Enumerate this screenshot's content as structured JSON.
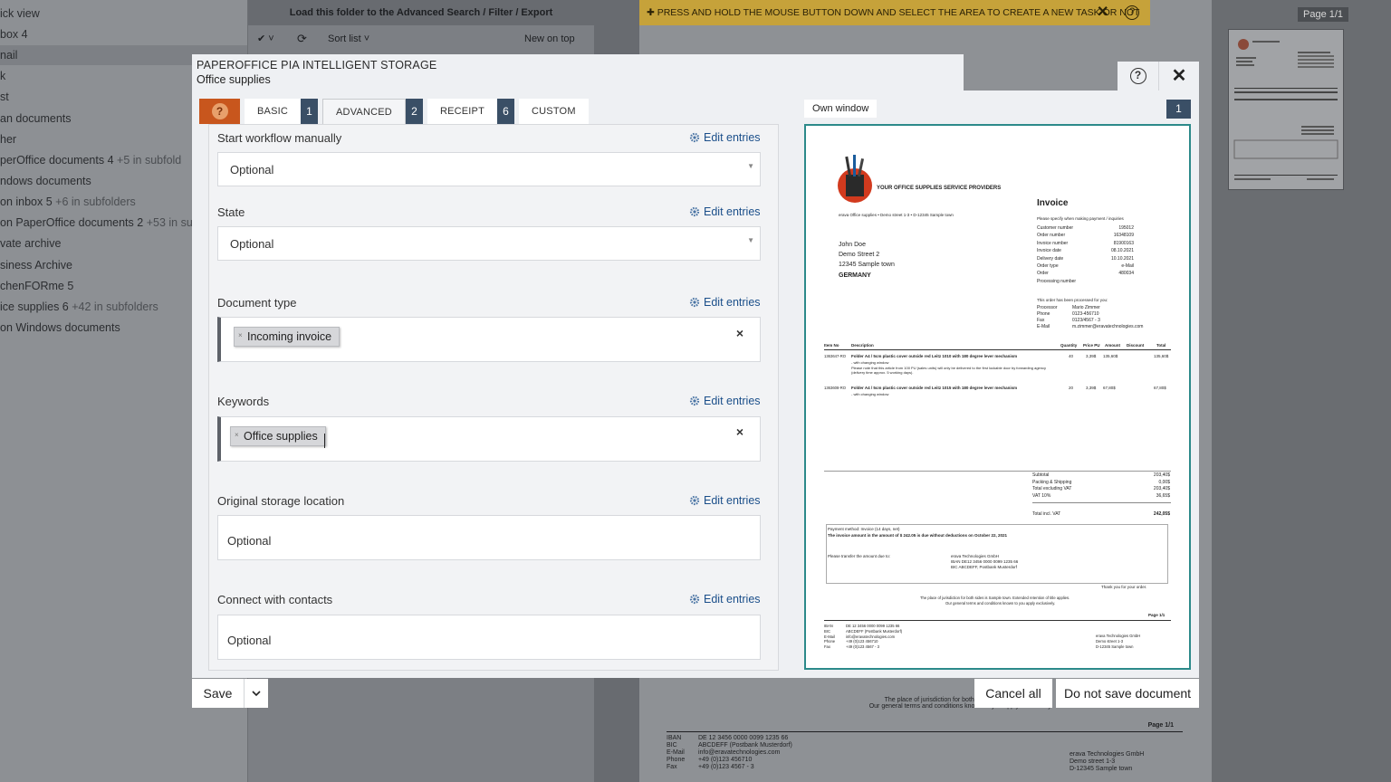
{
  "background": {
    "sidebar_items": [
      {
        "label": "ick view",
        "sub": ""
      },
      {
        "label": "box 4",
        "sub": ""
      },
      {
        "label": "nail",
        "sub": ""
      },
      {
        "label": "k",
        "sub": ""
      },
      {
        "label": "st",
        "sub": ""
      },
      {
        "label": "an documents",
        "sub": ""
      },
      {
        "label": "her",
        "sub": ""
      },
      {
        "label": "perOffice documents 4",
        "sub": "+5 in subfold"
      },
      {
        "label": "ndows documents",
        "sub": ""
      },
      {
        "label": "on inbox 5",
        "sub": "+6 in subfolders"
      },
      {
        "label": "on PaperOffice documents 2",
        "sub": "+53 in sub"
      },
      {
        "label": "vate archive",
        "sub": ""
      },
      {
        "label": "siness Archive",
        "sub": ""
      },
      {
        "label": "chenFORme 5",
        "sub": ""
      },
      {
        "label": "ice supplies 6",
        "sub": "+42 in subfolders"
      },
      {
        "label": "on Windows documents",
        "sub": ""
      }
    ],
    "list_toolbar_title": "Load this folder to the Advanced Search / Filter / Export",
    "list_check": "✔ ˅",
    "list_refresh": "⟳",
    "list_sort": "Sort list ˅",
    "list_order": "New on top",
    "banner_text": "✚ PRESS AND HOLD THE MOUSE BUTTON DOWN AND SELECT THE AREA TO CREATE A NEW TASK OR NOT",
    "banner_close": "✕",
    "banner_help": "?",
    "page_label": "Page 1/1",
    "doc_footer_line1": "The place of jurisdiction for both sides is Sample town.",
    "doc_footer_line2": "Our general terms and conditions known to you apply exclusively.",
    "doc_footer_page": "Page 1/1",
    "doc_footer_bank": [
      "IBAN",
      "BIC",
      "E-Mail",
      "Phone",
      "Fax"
    ],
    "doc_footer_bank_vals": [
      "DE 12 3456 0000 0099 1235 66",
      "ABCDEFF (Postbank Musterdorf)",
      "info@eravatechnologies.com",
      "+49 (0)123 456710",
      "+49 (0)123 4567 - 3"
    ],
    "doc_footer_company": [
      "erava Technologies GmbH",
      "Demo street 1-3",
      "D-12345 Sample town"
    ]
  },
  "dialog": {
    "app_title": "PAPEROFFICE PIA INTELLIGENT STORAGE",
    "folder": "Office supplies",
    "help_glyph": "?",
    "close_glyph": "✕",
    "tab_help_glyph": "?",
    "tabs": [
      {
        "label": "BASIC",
        "count": "1"
      },
      {
        "label": "ADVANCED",
        "count": "2"
      },
      {
        "label": "RECEIPT",
        "count": "6"
      },
      {
        "label": "CUSTOM",
        "count": ""
      }
    ],
    "edit_label": "Edit entries",
    "fields": {
      "workflow": {
        "label": "Start workflow manually",
        "value": "Optional"
      },
      "state": {
        "label": "State",
        "value": "Optional"
      },
      "doctype": {
        "label": "Document type",
        "chip": "Incoming invoice"
      },
      "keywords": {
        "label": "Keywords",
        "chip": "Office supplies"
      },
      "storage": {
        "label": "Original storage location",
        "value": "Optional"
      },
      "contacts": {
        "label": "Connect with contacts",
        "value": "Optional"
      }
    },
    "chip_remove": "×",
    "clear_glyph": "×",
    "dropdown_glyph": "▼",
    "own_window": "Own window",
    "page_badge": "1",
    "save": "Save",
    "cancel_all": "Cancel all",
    "do_not_save": "Do not save document"
  },
  "invoice": {
    "company_tag": "YOUR OFFICE SUPPLIES    SERVICE PROVIDERS",
    "sender_line": "erava Office supplies • Demo street 1-3 • D-12345 Sample town",
    "recipient": [
      "John Doe",
      "Demo Street 2",
      "12345 Sample town",
      "GERMANY"
    ],
    "title": "Invoice",
    "meta_intro": "Please specify when making payment / inquiries",
    "meta_labels": [
      "Customer number",
      "Order number",
      "Invoice number",
      "Invoice date",
      "Delivery date",
      "Order type",
      "Order",
      "Processing number"
    ],
    "meta_values": [
      "195012",
      "16348109",
      "81900163",
      "08.10.2021",
      "10.10.2021",
      "e-Mail",
      "480034",
      ""
    ],
    "processed_by": "This order has been processed for you:",
    "contact_labels": [
      "Processor",
      "Phone",
      "Fax",
      "E-Mail"
    ],
    "contact_values": [
      "Mario Zimmer",
      "0123-456710",
      "0123/4567 - 3",
      "m.zimmer@eravatechnologies.com"
    ],
    "table_headers": [
      "Item No",
      "Description",
      "Quantity",
      "Price PU",
      "Amount",
      "Discount",
      "Total"
    ],
    "rows": [
      {
        "no": "1363647-RO",
        "desc": "Folder A4 / 5cm plastic cover outside red Leitz 1010 with 180 degree lever mechanism",
        "qty": "40",
        "pu": "3,39$",
        "amt": "135,60$",
        "total": "135,60$",
        "note": "- with changing window"
      },
      {
        "no": "1363608-RO",
        "desc": "Folder A4 / 5cm plastic cover outside red Leitz 1015 with 180 degree lever mechanism",
        "qty": "20",
        "pu": "3,39$",
        "amt": "67,80$",
        "total": "67,80$",
        "note": "- with changing window"
      }
    ],
    "row_note": "Please note that this article from 100 PU (sales units) will only be delivered to the first lockable door by forwarding agency (delivery time approx. 5 working days).",
    "totals_labels": [
      "Subtotal",
      "Packing & Shipping",
      "Total excluding VAT",
      "VAT 10%",
      "Total incl. VAT"
    ],
    "totals_values": [
      "203,40$",
      "0,00$",
      "203,40$",
      "36,65$",
      "242,05$"
    ],
    "payment_lines": [
      "Payment method: Invoice (14 days, net)",
      "The invoice amount in the amount of $ 242.05 is due without deductions on October 22, 2021",
      "Please transfer the amount due to:"
    ],
    "bank_lines": [
      "erava Technologies GmbH",
      "IBAN  DE12 3456 0000 0099 1235 66",
      "BIC   ABCDEFF, Postbank Musterdorf"
    ],
    "thanks": "Thank you for your order.",
    "jurisdiction": "The place of jurisdiction for both sides is Sample town. Extended retention of title applies.",
    "terms": "Our general terms and conditions known to you apply exclusively.",
    "page": "Page 1/1",
    "footer_labels": [
      "IBAN",
      "BIC",
      "E-Mail",
      "Phone",
      "Fax"
    ],
    "footer_values": [
      "DE 12 3456 0000 0099 1235 66",
      "ABCDEFF (Postbank Musterdorf)",
      "info@eravatechnologies.com",
      "+49 (0)123 456710",
      "+49 (0)123 4567 - 3"
    ],
    "footer_company": [
      "erava Technologies GmbH",
      "Demo street 1-3",
      "D-12345 Sample town"
    ]
  },
  "colors": {
    "accent_orange": "#c8561d",
    "tab_badge": "#3a4f66",
    "preview_border": "#2c8a8a",
    "link": "#1b4f8a",
    "banner": "#c6a23a"
  }
}
